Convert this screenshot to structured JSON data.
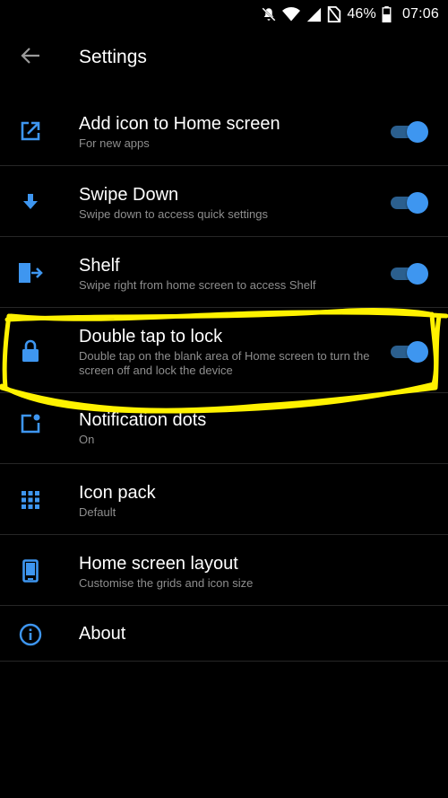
{
  "status_bar": {
    "battery": "46%",
    "time": "07:06",
    "icons": [
      "mute-icon",
      "wifi-icon",
      "signal-icon",
      "no-sim-icon",
      "battery-icon"
    ]
  },
  "app_bar": {
    "title": "Settings"
  },
  "accent_color": "#3e96f0",
  "highlight_color": "#fff200",
  "settings": [
    {
      "title": "Add icon to Home screen",
      "subtitle": "For new apps",
      "icon": "add-to-home-icon",
      "toggle": true
    },
    {
      "title": "Swipe Down",
      "subtitle": "Swipe down to access quick settings",
      "icon": "arrow-down-icon",
      "toggle": true
    },
    {
      "title": "Shelf",
      "subtitle": "Swipe right from home screen to access Shelf",
      "icon": "shelf-icon",
      "toggle": true
    },
    {
      "title": "Double tap to lock",
      "subtitle": "Double tap on the blank area of Home screen to turn the screen off and lock the device",
      "icon": "lock-icon",
      "toggle": true
    },
    {
      "title": "Notification dots",
      "subtitle": "On",
      "icon": "notification-dot-icon"
    },
    {
      "title": "Icon pack",
      "subtitle": "Default",
      "icon": "grid-icon"
    },
    {
      "title": "Home screen layout",
      "subtitle": "Customise the grids and icon size",
      "icon": "phone-layout-icon"
    },
    {
      "title": "About",
      "icon": "info-icon"
    }
  ]
}
